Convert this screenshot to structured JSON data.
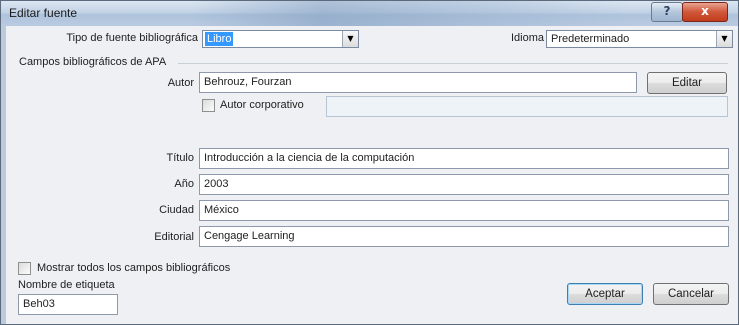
{
  "window": {
    "title": "Editar fuente",
    "help_label": "?",
    "close_label": "x"
  },
  "source_type": {
    "label": "Tipo de fuente bibliográfica",
    "value": "Libro"
  },
  "language": {
    "label": "Idioma",
    "value": "Predeterminado"
  },
  "group": {
    "title": "Campos bibliográficos de APA"
  },
  "author": {
    "label": "Autor",
    "value": "Behrouz, Fourzan",
    "edit_button": "Editar"
  },
  "corporate_author": {
    "label": "Autor corporativo",
    "checked": false,
    "value": ""
  },
  "fields": [
    {
      "label": "Título",
      "value": "Introducción a la ciencia de la computación"
    },
    {
      "label": "Año",
      "value": "2003"
    },
    {
      "label": "Ciudad",
      "value": "México"
    },
    {
      "label": "Editorial",
      "value": "Cengage Learning"
    }
  ],
  "show_all": {
    "label": "Mostrar todos los campos bibliográficos",
    "checked": false
  },
  "tag": {
    "label": "Nombre de etiqueta",
    "value": "Beh03"
  },
  "buttons": {
    "accept": "Aceptar",
    "cancel": "Cancelar"
  },
  "icons": {
    "dropdown": "chevron-down-icon",
    "help": "help-icon",
    "close": "close-icon"
  }
}
